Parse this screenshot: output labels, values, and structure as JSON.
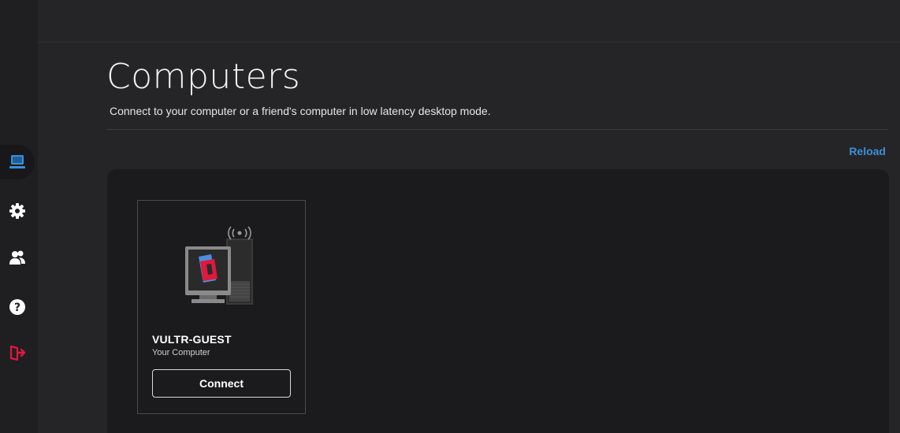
{
  "sidebar": {
    "items": [
      {
        "icon": "computer-icon",
        "active": true
      },
      {
        "icon": "gear-icon"
      },
      {
        "icon": "users-icon"
      },
      {
        "icon": "help-icon"
      },
      {
        "icon": "logout-icon",
        "color": "#e0183c"
      }
    ]
  },
  "page": {
    "title": "Computers",
    "subtitle": "Connect to your computer or a friend's computer in low latency desktop mode.",
    "reload_label": "Reload"
  },
  "computers": [
    {
      "name": "VULTR-GUEST",
      "subtitle": "Your Computer",
      "connect_label": "Connect"
    }
  ],
  "colors": {
    "accent": "#3d8fd6",
    "brand_red": "#e0183c",
    "brand_blue": "#4a8fe0",
    "background": "#252527",
    "panel": "#1b1b1d"
  }
}
